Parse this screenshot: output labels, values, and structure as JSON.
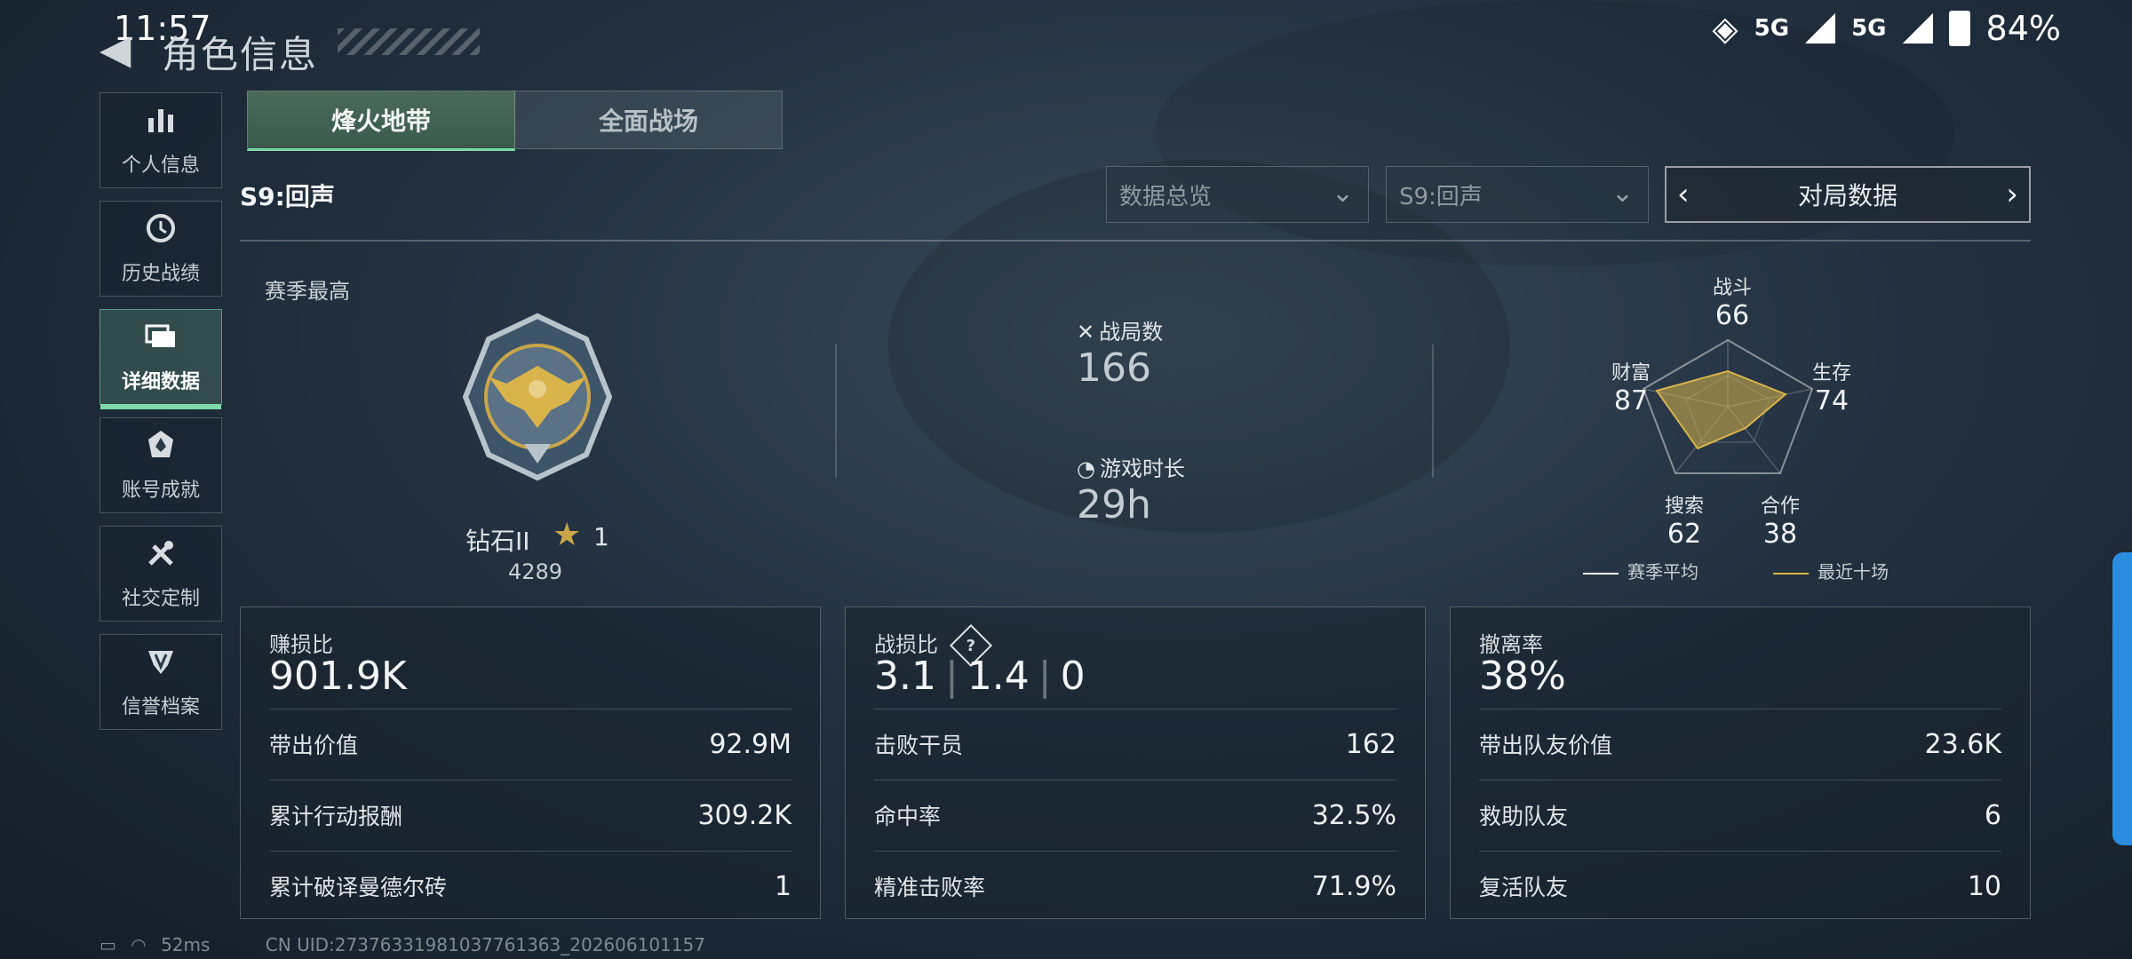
{
  "status_bar": {
    "time": "11:57",
    "net1": "5G",
    "net2": "5G",
    "battery": "84%"
  },
  "header": {
    "title": "角色信息"
  },
  "sidebar": {
    "items": [
      {
        "label": "个人信息",
        "icon": "bar-chart-icon"
      },
      {
        "label": "历史战绩",
        "icon": "clock-icon"
      },
      {
        "label": "详细数据",
        "icon": "cards-icon"
      },
      {
        "label": "账号成就",
        "icon": "badge-icon"
      },
      {
        "label": "社交定制",
        "icon": "tools-icon"
      },
      {
        "label": "信誉档案",
        "icon": "shield-icon"
      }
    ]
  },
  "tabs": [
    {
      "label": "烽火地带"
    },
    {
      "label": "全面战场"
    }
  ],
  "filters": {
    "season_label": "S9:回声",
    "overview": "数据总览",
    "season_select": "S9:回声",
    "nav_label": "对局数据"
  },
  "summary": {
    "season_best_label": "赛季最高",
    "rank": "钻石II",
    "rank_stars": "1",
    "rank_points": "4289",
    "matches_label": "战局数",
    "matches_value": "166",
    "playtime_label": "游戏时长",
    "playtime_value": "29h"
  },
  "radar": {
    "axes": [
      {
        "label": "战斗",
        "value": "66"
      },
      {
        "label": "生存",
        "value": "74"
      },
      {
        "label": "合作",
        "value": "38"
      },
      {
        "label": "搜索",
        "value": "62"
      },
      {
        "label": "财富",
        "value": "87"
      }
    ],
    "legend": [
      {
        "label": "赛季平均",
        "color": "#ffffff"
      },
      {
        "label": "最近十场",
        "color": "#d9b44a"
      }
    ]
  },
  "cards": [
    {
      "title": "赚损比",
      "value": "901.9K",
      "rows": [
        {
          "label": "带出价值",
          "value": "92.9M"
        },
        {
          "label": "累计行动报酬",
          "value": "309.2K"
        },
        {
          "label": "累计破译曼德尔砖",
          "value": "1"
        }
      ]
    },
    {
      "title": "战损比",
      "values": [
        "3.1",
        "1.4",
        "0"
      ],
      "help": "?",
      "rows": [
        {
          "label": "击败干员",
          "value": "162"
        },
        {
          "label": "命中率",
          "value": "32.5%"
        },
        {
          "label": "精准击败率",
          "value": "71.9%"
        }
      ]
    },
    {
      "title": "撤离率",
      "value": "38%",
      "rows": [
        {
          "label": "带出队友价值",
          "value": "23.6K"
        },
        {
          "label": "救助队友",
          "value": "6"
        },
        {
          "label": "复活队友",
          "value": "10"
        }
      ]
    }
  ],
  "footer": {
    "ping": "52ms",
    "uid": "CN UID:27376331981037761363_202606101157"
  }
}
